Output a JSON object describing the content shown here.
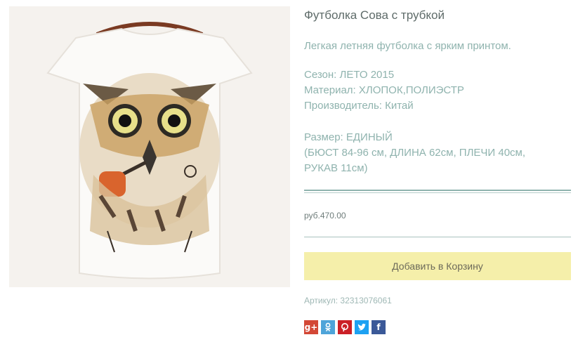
{
  "product": {
    "title": "Футболка Сова с трубкой",
    "description": "Легкая летняя футболка с ярким принтом.",
    "specs": [
      "Сезон: ЛЕТО 2015",
      "Материал: ХЛОПОК,ПОЛИЭСТР",
      "Производитель: Китай"
    ],
    "size": [
      "Размер: ЕДИНЫЙ",
      "(БЮСТ 84-96 см, ДЛИНА 62см, ПЛЕЧИ 40см,",
      "РУКАВ 11см)"
    ],
    "price": "руб.470.00",
    "add_to_cart": "Добавить в Корзину",
    "sku": "Артикул: 32313076061"
  },
  "share": [
    {
      "name": "google-plus-icon",
      "glyph": "g+",
      "color": "#d34836"
    },
    {
      "name": "odnoklassniki-icon",
      "glyph": "",
      "color": "#4ea4d9"
    },
    {
      "name": "pinterest-icon",
      "glyph": "",
      "color": "#cb2027"
    },
    {
      "name": "twitter-icon",
      "glyph": "",
      "color": "#1da1f2"
    },
    {
      "name": "facebook-icon",
      "glyph": "f",
      "color": "#3b5998"
    }
  ],
  "colors": {
    "accent_text": "#8fb3ae",
    "title_text": "#5e6b69",
    "button_bg": "#f5efaa"
  }
}
